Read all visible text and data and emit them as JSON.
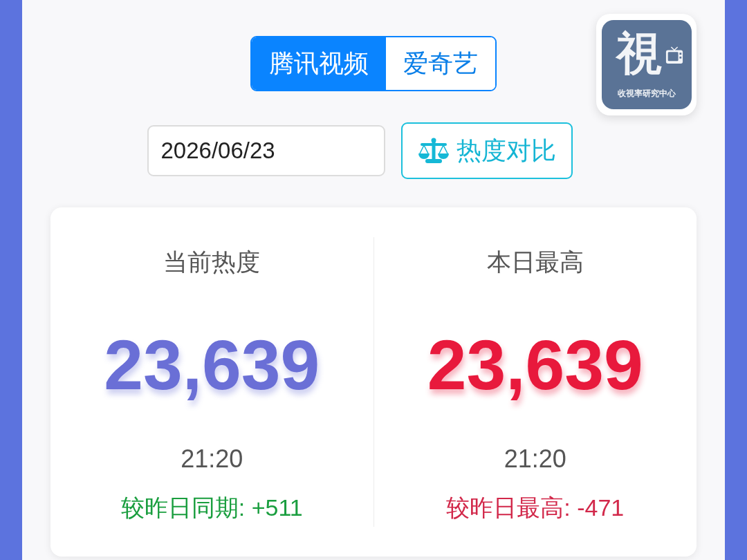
{
  "tabs": [
    {
      "label": "腾讯视频",
      "selected": true
    },
    {
      "label": "爱奇艺",
      "selected": false
    }
  ],
  "logo": {
    "glyph": "視",
    "caption": "收視率研究中心"
  },
  "date_field": {
    "value": "2026/06/23"
  },
  "compare_button": {
    "label": "热度对比"
  },
  "stats": [
    {
      "label": "当前热度",
      "value": "23,639",
      "color": "#6a6fd6",
      "time": "21:20",
      "change": {
        "text": "较昨日同期: +511",
        "color": "#1a9e3f"
      }
    },
    {
      "label": "本日最高",
      "value": "23,639",
      "color": "#e8193c",
      "time": "21:20",
      "change": {
        "text": "较昨日最高: -471",
        "color": "#d2284a"
      }
    }
  ]
}
